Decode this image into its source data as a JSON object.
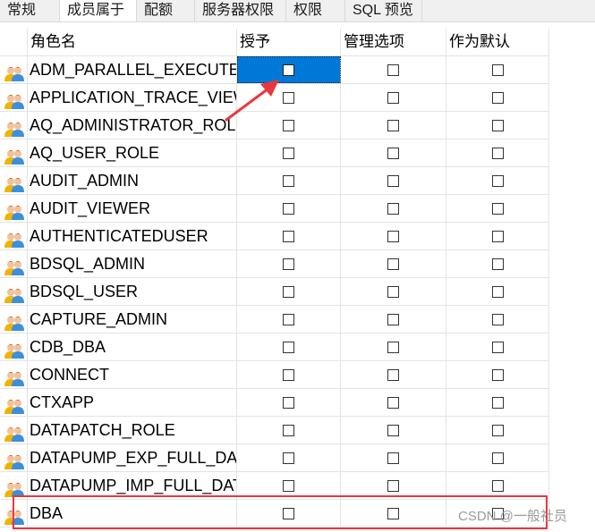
{
  "tabs": [
    {
      "label": "常规",
      "active": false
    },
    {
      "label": "成员属于",
      "active": true
    },
    {
      "label": "配额",
      "active": false
    },
    {
      "label": "服务器权限",
      "active": false
    },
    {
      "label": "权限",
      "active": false
    },
    {
      "label": "SQL 预览",
      "active": false
    }
  ],
  "table": {
    "columns": [
      "角色名",
      "授予",
      "管理选项",
      "作为默认"
    ],
    "rows": [
      {
        "name": "ADM_PARALLEL_EXECUTE_TASK",
        "display": "ADM_PARALLEL_EXECUTE_",
        "grant": false,
        "admin": false,
        "default": false,
        "selected_cell": "grant"
      },
      {
        "name": "APPLICATION_TRACE_VIEWER",
        "display": "APPLICATION_TRACE_VIEW",
        "grant": false,
        "admin": false,
        "default": false
      },
      {
        "name": "AQ_ADMINISTRATOR_ROLE",
        "display": "AQ_ADMINISTRATOR_ROL",
        "grant": false,
        "admin": false,
        "default": false
      },
      {
        "name": "AQ_USER_ROLE",
        "display": "AQ_USER_ROLE",
        "grant": false,
        "admin": false,
        "default": false
      },
      {
        "name": "AUDIT_ADMIN",
        "display": "AUDIT_ADMIN",
        "grant": false,
        "admin": false,
        "default": false
      },
      {
        "name": "AUDIT_VIEWER",
        "display": "AUDIT_VIEWER",
        "grant": false,
        "admin": false,
        "default": false
      },
      {
        "name": "AUTHENTICATEDUSER",
        "display": "AUTHENTICATEDUSER",
        "grant": false,
        "admin": false,
        "default": false
      },
      {
        "name": "BDSQL_ADMIN",
        "display": "BDSQL_ADMIN",
        "grant": false,
        "admin": false,
        "default": false
      },
      {
        "name": "BDSQL_USER",
        "display": "BDSQL_USER",
        "grant": false,
        "admin": false,
        "default": false
      },
      {
        "name": "CAPTURE_ADMIN",
        "display": "CAPTURE_ADMIN",
        "grant": false,
        "admin": false,
        "default": false
      },
      {
        "name": "CDB_DBA",
        "display": "CDB_DBA",
        "grant": false,
        "admin": false,
        "default": false
      },
      {
        "name": "CONNECT",
        "display": "CONNECT",
        "grant": false,
        "admin": false,
        "default": false
      },
      {
        "name": "CTXAPP",
        "display": "CTXAPP",
        "grant": false,
        "admin": false,
        "default": false
      },
      {
        "name": "DATAPATCH_ROLE",
        "display": "DATAPATCH_ROLE",
        "grant": false,
        "admin": false,
        "default": false
      },
      {
        "name": "DATAPUMP_EXP_FULL_DATABASE",
        "display": "DATAPUMP_EXP_FULL_DAT",
        "grant": false,
        "admin": false,
        "default": false
      },
      {
        "name": "DATAPUMP_IMP_FULL_DATABASE",
        "display": "DATAPUMP_IMP_FULL_DAT",
        "grant": false,
        "admin": false,
        "default": false
      },
      {
        "name": "DBA",
        "display": "DBA",
        "grant": false,
        "admin": false,
        "default": false,
        "highlighted": true
      }
    ]
  },
  "icons": {
    "role": "role-group-icon"
  },
  "colors": {
    "selection": "#0078d7",
    "annotation": "#e8383d"
  },
  "watermark": "CSDN @一般社员"
}
